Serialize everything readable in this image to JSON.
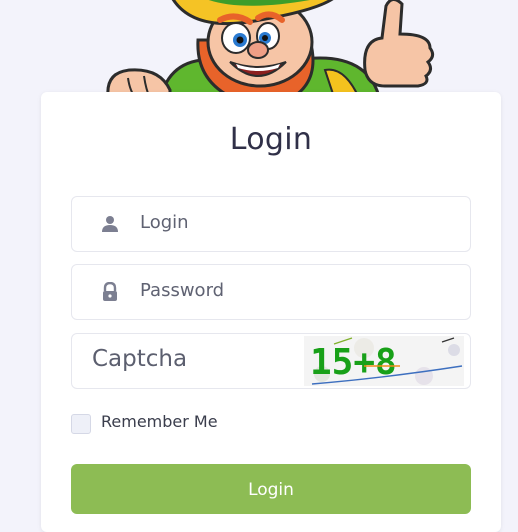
{
  "form": {
    "title": "Login",
    "login_placeholder": "Login",
    "password_placeholder": "Password",
    "captcha_placeholder": "Captcha",
    "remember_label": "Remember Me",
    "submit_label": "Login"
  },
  "captcha_image": {
    "text": "15+8"
  },
  "colors": {
    "page_background": "#f3f3fb",
    "button": "#8dbc54",
    "title_text": "#303048"
  },
  "icons": {
    "login": "user-icon",
    "password": "lock-icon"
  }
}
